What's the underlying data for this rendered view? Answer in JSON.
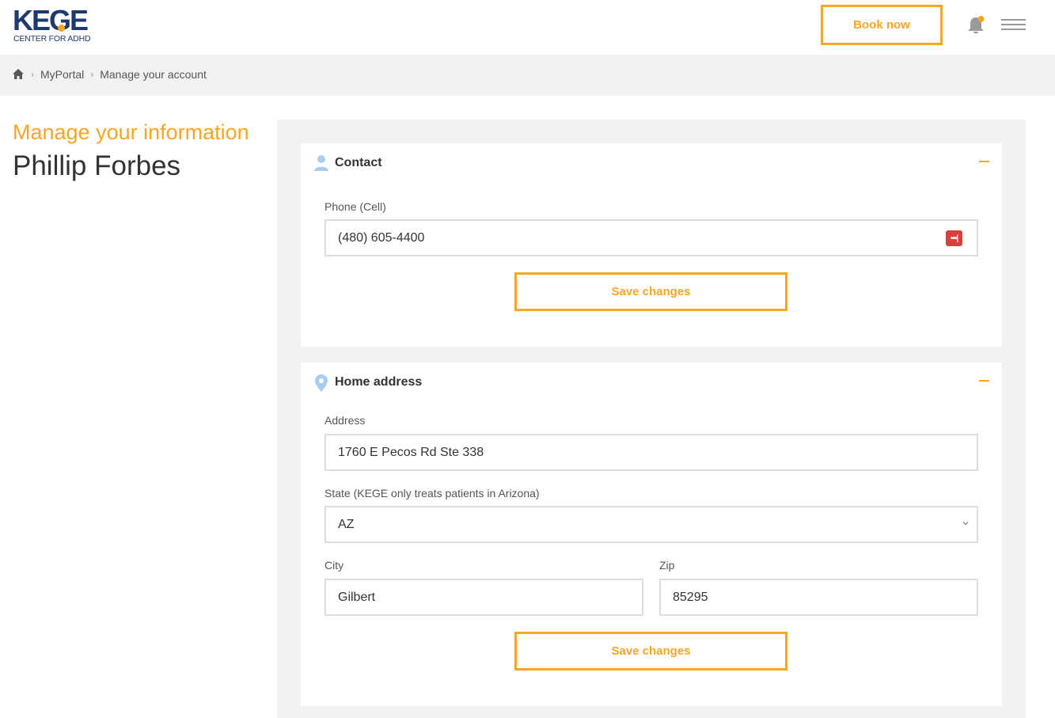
{
  "header": {
    "logo_main": "KEGE",
    "logo_sub": "CENTER FOR ADHD",
    "book_label": "Book now",
    "accent_color": "#f5a623",
    "brand_color": "#1d3a6e"
  },
  "breadcrumb": {
    "items": [
      "MyPortal",
      "Manage your account"
    ],
    "separator": "›"
  },
  "profile": {
    "heading": "Manage your information",
    "name": "Phillip Forbes"
  },
  "contact": {
    "title": "Contact",
    "phone_label": "Phone (Cell)",
    "phone_value": "(480) 605-4400",
    "password_badge": "•••|",
    "save_label": "Save changes"
  },
  "address": {
    "title": "Home address",
    "address_label": "Address",
    "address_value": "1760 E Pecos Rd Ste 338",
    "state_label": "State (KEGE only treats patients in Arizona)",
    "state_value": "AZ",
    "city_label": "City",
    "city_value": "Gilbert",
    "zip_label": "Zip",
    "zip_value": "85295",
    "save_label": "Save changes"
  },
  "icons": {
    "home": "home-icon",
    "bell": "bell-icon",
    "menu": "hamburger-menu-icon",
    "person": "person-icon",
    "location": "location-pin-icon",
    "collapse": "minus-icon",
    "chevron": "chevron-down-icon",
    "password": "password-manager-icon"
  }
}
